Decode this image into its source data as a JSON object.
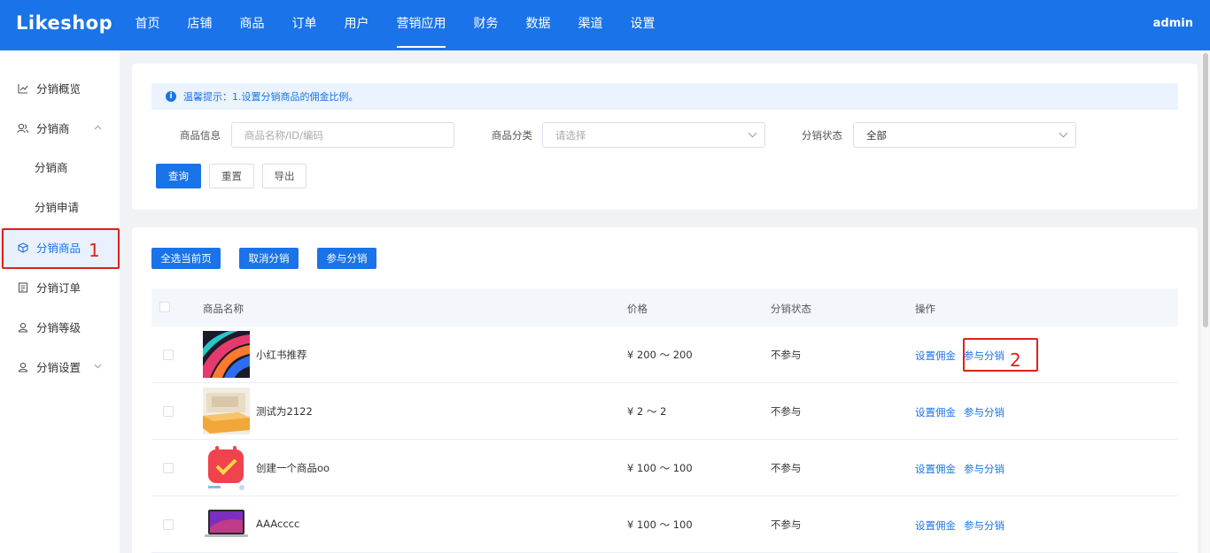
{
  "header": {
    "logo": "Likeshop",
    "nav": [
      {
        "label": "首页"
      },
      {
        "label": "店铺"
      },
      {
        "label": "商品"
      },
      {
        "label": "订单"
      },
      {
        "label": "用户"
      },
      {
        "label": "营销应用",
        "active": true
      },
      {
        "label": "财务"
      },
      {
        "label": "数据"
      },
      {
        "label": "渠道"
      },
      {
        "label": "设置"
      }
    ],
    "user": "admin"
  },
  "sidebar": {
    "items": [
      {
        "label": "分销概览",
        "icon": "chart-line-icon"
      },
      {
        "label": "分销商",
        "icon": "users-icon",
        "chevron": "up"
      },
      {
        "label": "分销商",
        "sub": true
      },
      {
        "label": "分销申请",
        "sub": true
      },
      {
        "label": "分销商品",
        "icon": "cube-icon",
        "active": true
      },
      {
        "label": "分销订单",
        "icon": "order-icon"
      },
      {
        "label": "分销等级",
        "icon": "user-icon"
      },
      {
        "label": "分销设置",
        "icon": "user-icon",
        "chevron": "down"
      }
    ]
  },
  "annotations": {
    "mark1": "1",
    "mark2": "2"
  },
  "filter": {
    "tip": "温馨提示：1.设置分销商品的佣金比例。",
    "goods_info_label": "商品信息",
    "goods_info_placeholder": "商品名称/ID/编码",
    "category_label": "商品分类",
    "category_placeholder": "请选择",
    "status_label": "分销状态",
    "status_value": "全部",
    "query": "查询",
    "reset": "重置",
    "export": "导出"
  },
  "actions": {
    "select_page": "全选当前页",
    "cancel_dist": "取消分销",
    "join_dist": "参与分销"
  },
  "table": {
    "headers": {
      "name": "商品名称",
      "price": "价格",
      "status": "分销状态",
      "ops": "操作"
    },
    "rows": [
      {
        "name": "小红书推荐",
        "price": "¥ 200 ～ 200",
        "status": "不参与",
        "op1": "设置佣金",
        "op2": "参与分销"
      },
      {
        "name": "测试为2122",
        "price": "¥ 2 ～ 2",
        "status": "不参与",
        "op1": "设置佣金",
        "op2": "参与分销"
      },
      {
        "name": "创建一个商品oo",
        "price": "¥ 100 ～ 100",
        "status": "不参与",
        "op1": "设置佣金",
        "op2": "参与分销"
      },
      {
        "name": "AAAcccc",
        "price": "¥ 100 ～ 100",
        "status": "不参与",
        "op1": "设置佣金",
        "op2": "参与分销"
      }
    ]
  },
  "colors": {
    "primary": "#1a73e8",
    "annotation": "#e0201b"
  }
}
